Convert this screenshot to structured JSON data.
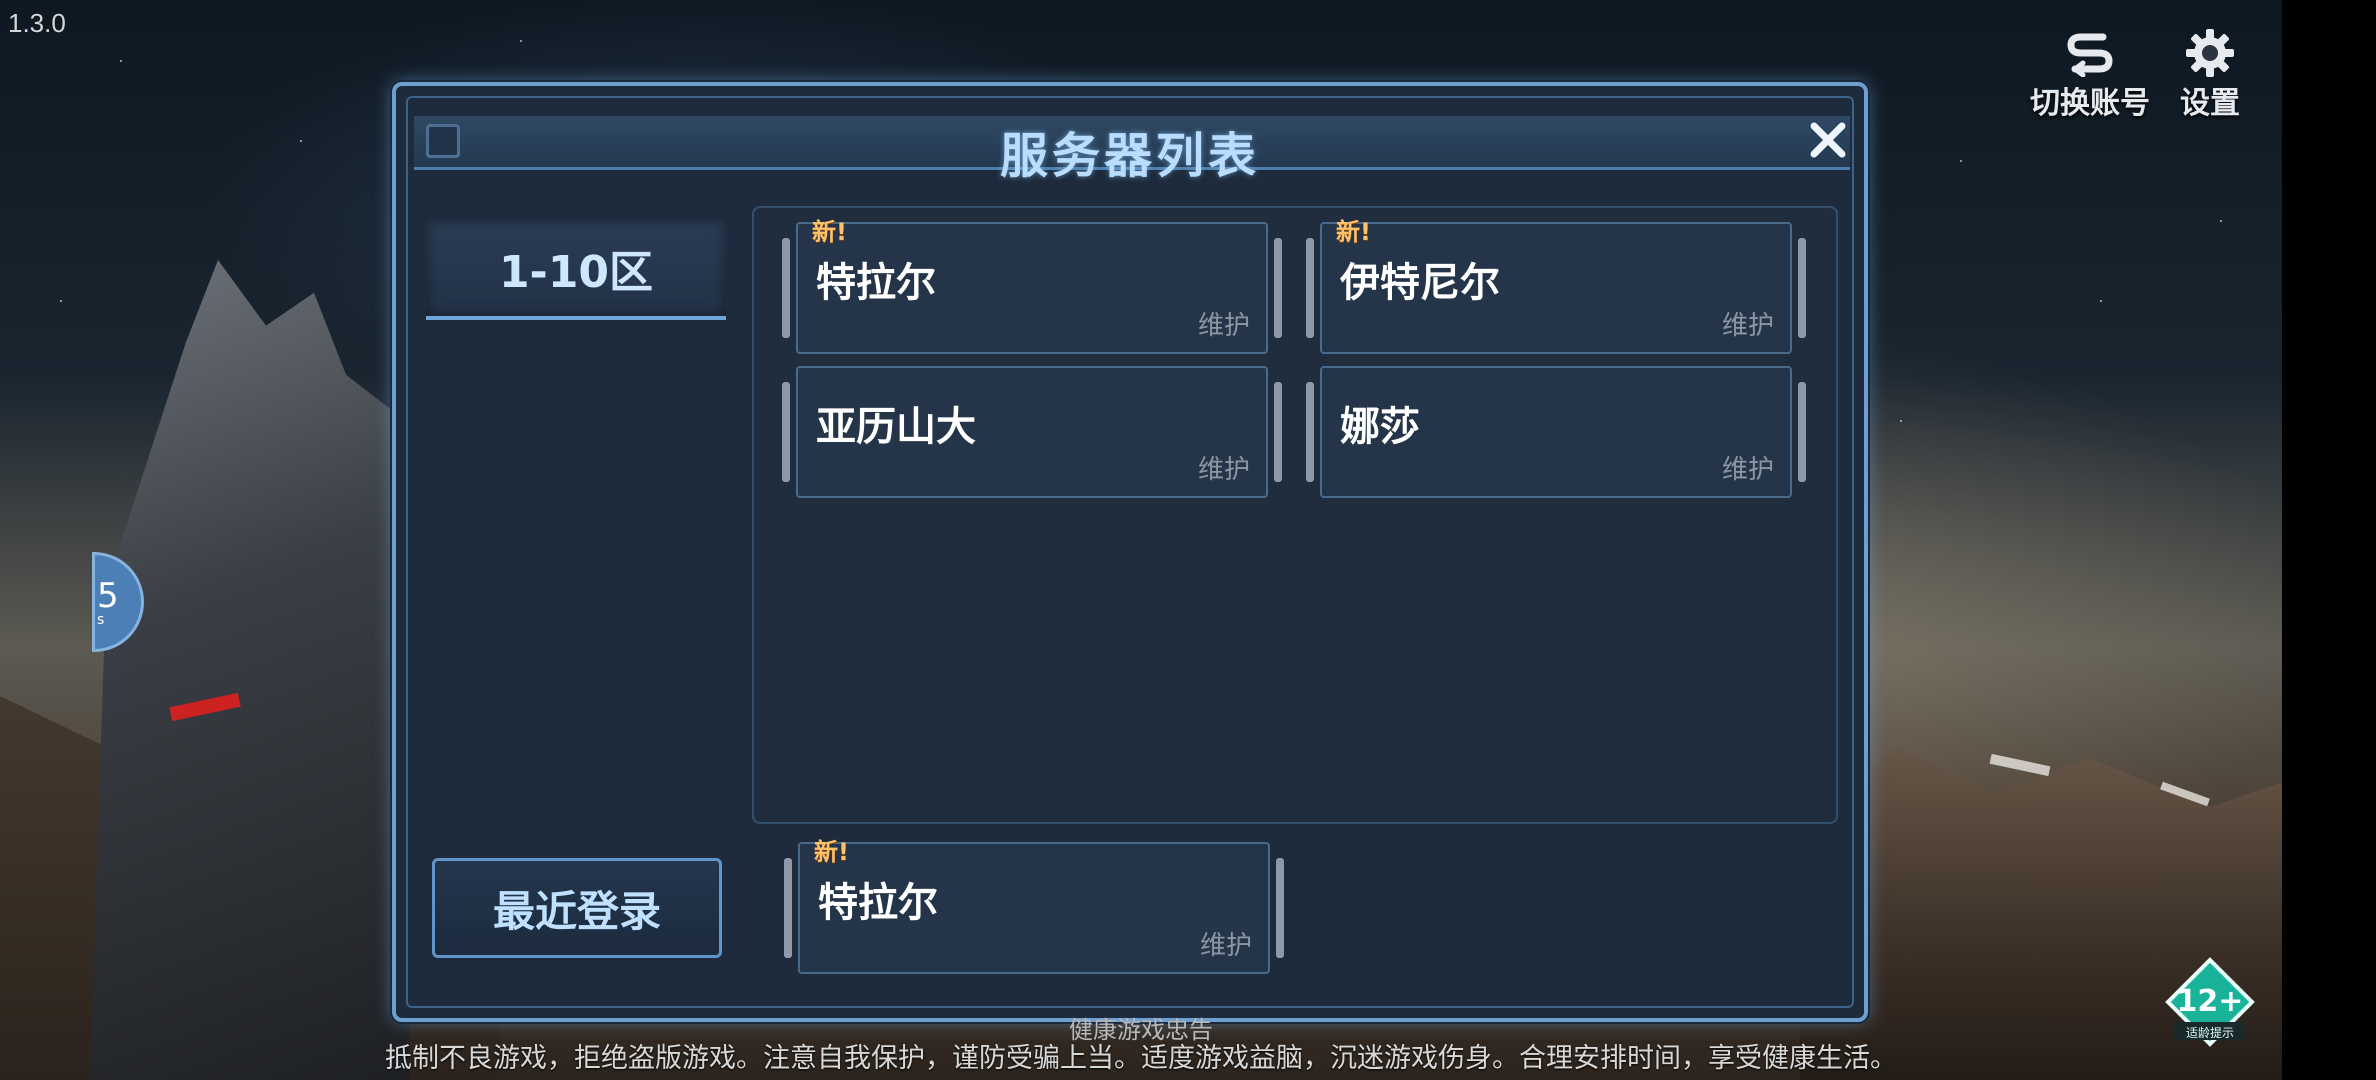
{
  "version": "1.3.0",
  "top_buttons": {
    "switch_account": "切换账号",
    "settings": "设置"
  },
  "side_bubble": {
    "number": "5",
    "suffix": "s"
  },
  "dialog": {
    "title": "服务器列表",
    "zone_tab": "1-10区",
    "recent_login": "最近登录",
    "servers": [
      {
        "name": "特拉尔",
        "status": "维护",
        "new_tag": "新!"
      },
      {
        "name": "伊特尼尔",
        "status": "维护",
        "new_tag": "新!"
      },
      {
        "name": "亚历山大",
        "status": "维护",
        "new_tag": ""
      },
      {
        "name": "娜莎",
        "status": "维护",
        "new_tag": ""
      }
    ],
    "recent_server": {
      "name": "特拉尔",
      "status": "维护",
      "new_tag": "新!"
    }
  },
  "footer": {
    "title": "健康游戏忠告",
    "notice": "抵制不良游戏，拒绝盗版游戏。注意自我保护，谨防受骗上当。适度游戏益脑，沉迷游戏伤身。合理安排时间，享受健康生活。"
  },
  "age_rating": {
    "label": "12+",
    "caption": "适龄提示"
  },
  "colors": {
    "accent": "#6d9fd0",
    "title": "#b8ddff",
    "new_tag": "#ffc16b",
    "status": "#8c97a3"
  }
}
